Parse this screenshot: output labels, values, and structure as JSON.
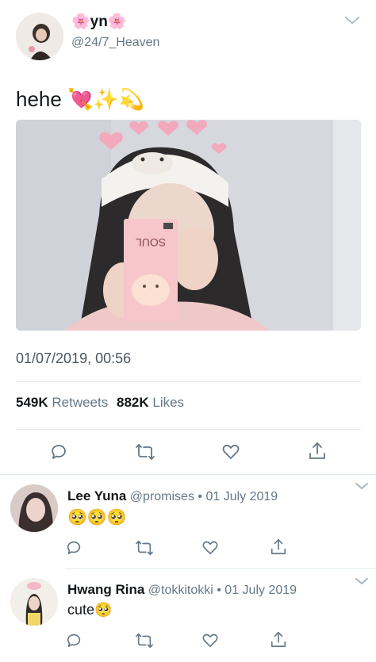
{
  "tweet": {
    "display_name": "🌸yn🌸",
    "handle": "@24/7_Heaven",
    "text": "hehe 💘✨💫",
    "timestamp": "01/07/2019, 00:56",
    "retweets_count": "549K",
    "retweets_label": "Retweets",
    "likes_count": "882K",
    "likes_label": "Likes",
    "photo_product_label": "SOUL"
  },
  "replies": [
    {
      "name": "Lee Yuna",
      "handle": "@promises",
      "date": "• 01 July 2019",
      "text": "🥺🥺🥺"
    },
    {
      "name": "Hwang Rina",
      "handle": "@tokkitokki",
      "date": "• 01 July 2019",
      "text": "cute🥺"
    }
  ],
  "icons": {
    "reply": "comment-icon",
    "retweet": "retweet-icon",
    "like": "heart-icon",
    "share": "share-icon",
    "more": "chevron-down-icon"
  },
  "colors": {
    "text": "#14171a",
    "muted": "#657786",
    "divider": "#e1e8ed"
  }
}
